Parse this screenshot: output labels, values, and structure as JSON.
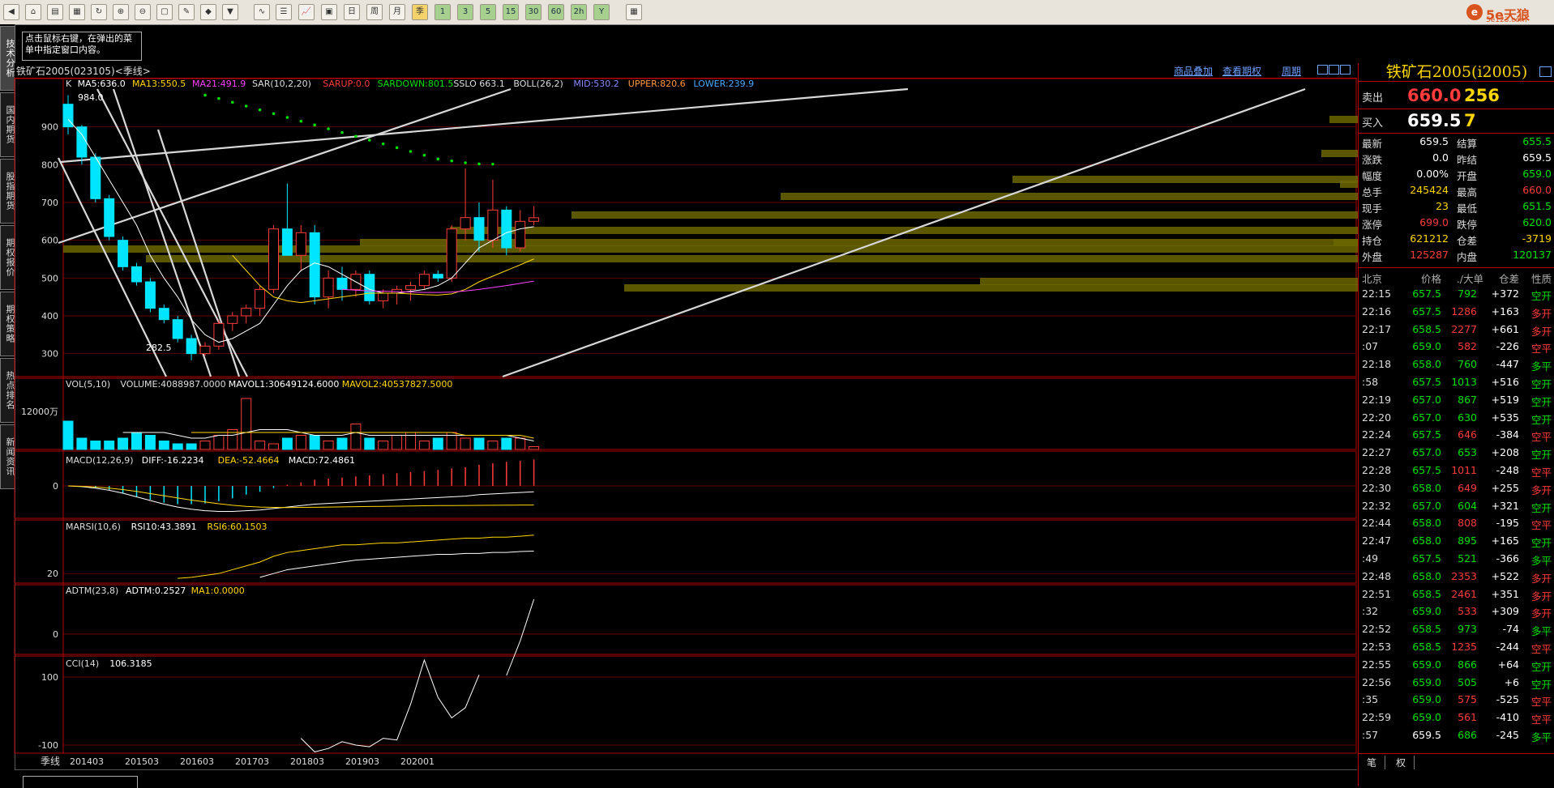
{
  "colors": {
    "up": "#ff3b3b",
    "down": "#00e5ff",
    "grid": "#8b0000",
    "text": "#dddddd",
    "bar": "#6b6600",
    "accent": "#ffd700"
  },
  "toolbar": {
    "icons": [
      "back-icon",
      "home-icon",
      "folder-icon",
      "quote-icon",
      "refresh-icon",
      "zoom-in-icon",
      "zoom-out-icon",
      "window-icon",
      "draw-icon",
      "paint-icon",
      "filter-icon",
      "indicator-icon",
      "list-icon",
      "chart-icon",
      "news-icon",
      "daily-icon",
      "weekly-icon",
      "monthly-icon",
      "quarterly-icon",
      "min1-icon",
      "min3-icon",
      "min5-icon",
      "min15-icon",
      "min30-icon",
      "min60-icon",
      "multi-icon",
      "year-icon",
      "calc-icon"
    ],
    "period_labels": [
      "1",
      "3",
      "5",
      "15",
      "30",
      "60",
      "2h",
      "Y"
    ],
    "brand": "5e天狼",
    "brand_url": "5e123.com"
  },
  "left_tabs": [
    "技术分析",
    "国内期货",
    "股指期货",
    "期权报价",
    "期权策略",
    "热点排名",
    "新闻资讯"
  ],
  "hint": "点击鼠标右键，在弹出的菜单中指定窗口内容。",
  "chart": {
    "title": "铁矿石2005(023105)<季线>",
    "links": [
      "商品叠加",
      "查看期权",
      "周期"
    ],
    "main_legend": [
      {
        "text": "K",
        "color": "#dddddd"
      },
      {
        "text": "MA5:636.0",
        "color": "#ffffff"
      },
      {
        "text": "MA13:550.5",
        "color": "#ffd700"
      },
      {
        "text": "MA21:491.9",
        "color": "#ff40ff"
      },
      {
        "text": "SAR(10,2,20)",
        "color": "#dddddd"
      },
      {
        "text": "SARUP:0.0",
        "color": "#ff3b3b"
      },
      {
        "text": "SARDOWN:801.5",
        "color": "#00e000"
      },
      {
        "text": "SSLO 663.1",
        "color": "#dddddd"
      },
      {
        "text": "BOLL(26,2)",
        "color": "#dddddd"
      },
      {
        "text": "MID:530.2",
        "color": "#8a8aff"
      },
      {
        "text": "UPPER:820.6",
        "color": "#ff9a40"
      },
      {
        "text": "LOWER:239.9",
        "color": "#4aa8ff"
      }
    ],
    "main_axis": [
      "900",
      "800",
      "700",
      "600",
      "500",
      "400",
      "300"
    ],
    "high_label": "984.0",
    "low_label": "282.5",
    "vol_legend": [
      {
        "text": "VOL(5,10)",
        "color": "#dddddd"
      },
      {
        "text": "VOLUME:4088987.0000",
        "color": "#dddddd"
      },
      {
        "text": "MAVOL1:30649124.6000",
        "color": "#ffffff"
      },
      {
        "text": "MAVOL2:40537827.5000",
        "color": "#ffd700"
      }
    ],
    "vol_axis": "12000万",
    "macd_legend": [
      {
        "text": "MACD(12,26,9)",
        "color": "#dddddd"
      },
      {
        "text": "DIFF:-16.2234",
        "color": "#ffffff"
      },
      {
        "text": "DEA:-52.4664",
        "color": "#ffd700"
      },
      {
        "text": "MACD:72.4861",
        "color": "#ffffff"
      }
    ],
    "macd_axis": "0",
    "marsi_legend": [
      {
        "text": "MARSI(10,6)",
        "color": "#dddddd"
      },
      {
        "text": "RSI10:43.3891",
        "color": "#ffffff"
      },
      {
        "text": "RSI6:60.1503",
        "color": "#ffd700"
      }
    ],
    "marsi_axis": "20",
    "adtm_legend": [
      {
        "text": "ADTM(23,8)",
        "color": "#dddddd"
      },
      {
        "text": "ADTM:0.2527",
        "color": "#ffffff"
      },
      {
        "text": "MA1:0.0000",
        "color": "#ffd700"
      }
    ],
    "adtm_axis": "0",
    "cci_legend": [
      {
        "text": "CCI(14)",
        "color": "#dddddd"
      },
      {
        "text": "106.3185",
        "color": "#ffffff"
      }
    ],
    "cci_axis": [
      "100",
      "-100"
    ],
    "period_label": "季线",
    "x_labels": [
      "201403",
      "201503",
      "201603",
      "201703",
      "201803",
      "201903",
      "202001"
    ]
  },
  "quote": {
    "title": "铁矿石2005(i2005)",
    "sell": {
      "label": "卖出",
      "price": "660.0",
      "vol": "256"
    },
    "buy": {
      "label": "买入",
      "price": "659.5",
      "vol": "7"
    },
    "stats": [
      {
        "l1": "最新",
        "v1": "659.5",
        "c1": "#ffffff",
        "l2": "结算",
        "v2": "655.5",
        "c2": "#00e000"
      },
      {
        "l1": "涨跌",
        "v1": "0.0",
        "c1": "#ffffff",
        "l2": "昨结",
        "v2": "659.5",
        "c2": "#ffffff"
      },
      {
        "l1": "幅度",
        "v1": "0.00%",
        "c1": "#ffffff",
        "l2": "开盘",
        "v2": "659.0",
        "c2": "#00e000"
      },
      {
        "l1": "总手",
        "v1": "245424",
        "c1": "#ffd700",
        "l2": "最高",
        "v2": "660.0",
        "c2": "#ff3b3b"
      },
      {
        "l1": "现手",
        "v1": "23",
        "c1": "#ffd700",
        "l2": "最低",
        "v2": "651.5",
        "c2": "#00e000"
      },
      {
        "l1": "涨停",
        "v1": "699.0",
        "c1": "#ff3b3b",
        "l2": "跌停",
        "v2": "620.0",
        "c2": "#00e000"
      },
      {
        "l1": "持仓",
        "v1": "621212",
        "c1": "#ffd700",
        "l2": "仓差",
        "v2": "-3719",
        "c2": "#ffd700"
      },
      {
        "l1": "外盘",
        "v1": "125287",
        "c1": "#ff3b3b",
        "l2": "内盘",
        "v2": "120137",
        "c2": "#00e000"
      }
    ],
    "tick_header": {
      "time": "北京",
      "price": "价格",
      "vol": "./大单",
      "chg": "仓差",
      "nature": "性质"
    },
    "ticks": [
      {
        "time": "22:15",
        "price": "657.5",
        "vol": "792",
        "chg": "+372",
        "nature": "空开",
        "pc": "#00e000",
        "vc": "#00e000",
        "nc": "#00e000"
      },
      {
        "time": "22:16",
        "price": "657.5",
        "vol": "1286",
        "chg": "+163",
        "nature": "多开",
        "pc": "#00e000",
        "vc": "#ff3b3b",
        "nc": "#ff3b3b"
      },
      {
        "time": "22:17",
        "price": "658.5",
        "vol": "2277",
        "chg": "+661",
        "nature": "多开",
        "pc": "#00e000",
        "vc": "#ff3b3b",
        "nc": "#ff3b3b"
      },
      {
        "time": ":07",
        "price": "659.0",
        "vol": "582",
        "chg": "-226",
        "nature": "空平",
        "pc": "#00e000",
        "vc": "#ff3b3b",
        "nc": "#ff3b3b"
      },
      {
        "time": "22:18",
        "price": "658.0",
        "vol": "760",
        "chg": "-447",
        "nature": "多平",
        "pc": "#00e000",
        "vc": "#00e000",
        "nc": "#00e000"
      },
      {
        "time": ":58",
        "price": "657.5",
        "vol": "1013",
        "chg": "+516",
        "nature": "空开",
        "pc": "#00e000",
        "vc": "#00e000",
        "nc": "#00e000"
      },
      {
        "time": "22:19",
        "price": "657.0",
        "vol": "867",
        "chg": "+519",
        "nature": "空开",
        "pc": "#00e000",
        "vc": "#00e000",
        "nc": "#00e000"
      },
      {
        "time": "22:20",
        "price": "657.0",
        "vol": "630",
        "chg": "+535",
        "nature": "空开",
        "pc": "#00e000",
        "vc": "#00e000",
        "nc": "#00e000"
      },
      {
        "time": "22:24",
        "price": "657.5",
        "vol": "646",
        "chg": "-384",
        "nature": "空平",
        "pc": "#00e000",
        "vc": "#ff3b3b",
        "nc": "#ff3b3b"
      },
      {
        "time": "22:27",
        "price": "657.0",
        "vol": "653",
        "chg": "+208",
        "nature": "空开",
        "pc": "#00e000",
        "vc": "#00e000",
        "nc": "#00e000"
      },
      {
        "time": "22:28",
        "price": "657.5",
        "vol": "1011",
        "chg": "-248",
        "nature": "空平",
        "pc": "#00e000",
        "vc": "#ff3b3b",
        "nc": "#ff3b3b"
      },
      {
        "time": "22:30",
        "price": "658.0",
        "vol": "649",
        "chg": "+255",
        "nature": "多开",
        "pc": "#00e000",
        "vc": "#ff3b3b",
        "nc": "#ff3b3b"
      },
      {
        "time": "22:32",
        "price": "657.0",
        "vol": "604",
        "chg": "+321",
        "nature": "空开",
        "pc": "#00e000",
        "vc": "#00e000",
        "nc": "#00e000"
      },
      {
        "time": "22:44",
        "price": "658.0",
        "vol": "808",
        "chg": "-195",
        "nature": "空平",
        "pc": "#00e000",
        "vc": "#ff3b3b",
        "nc": "#ff3b3b"
      },
      {
        "time": "22:47",
        "price": "658.0",
        "vol": "895",
        "chg": "+165",
        "nature": "空开",
        "pc": "#00e000",
        "vc": "#00e000",
        "nc": "#00e000"
      },
      {
        "time": ":49",
        "price": "657.5",
        "vol": "521",
        "chg": "-366",
        "nature": "多平",
        "pc": "#00e000",
        "vc": "#00e000",
        "nc": "#00e000"
      },
      {
        "time": "22:48",
        "price": "658.0",
        "vol": "2353",
        "chg": "+522",
        "nature": "多开",
        "pc": "#00e000",
        "vc": "#ff3b3b",
        "nc": "#ff3b3b"
      },
      {
        "time": "22:51",
        "price": "658.5",
        "vol": "2461",
        "chg": "+351",
        "nature": "多开",
        "pc": "#00e000",
        "vc": "#ff3b3b",
        "nc": "#ff3b3b"
      },
      {
        "time": ":32",
        "price": "659.0",
        "vol": "533",
        "chg": "+309",
        "nature": "多开",
        "pc": "#00e000",
        "vc": "#ff3b3b",
        "nc": "#ff3b3b"
      },
      {
        "time": "22:52",
        "price": "658.5",
        "vol": "973",
        "chg": "-74",
        "nature": "多平",
        "pc": "#00e000",
        "vc": "#00e000",
        "nc": "#00e000"
      },
      {
        "time": "22:53",
        "price": "658.5",
        "vol": "1235",
        "chg": "-244",
        "nature": "空平",
        "pc": "#00e000",
        "vc": "#ff3b3b",
        "nc": "#ff3b3b"
      },
      {
        "time": "22:55",
        "price": "659.0",
        "vol": "866",
        "chg": "+64",
        "nature": "空开",
        "pc": "#00e000",
        "vc": "#00e000",
        "nc": "#00e000"
      },
      {
        "time": "22:56",
        "price": "659.0",
        "vol": "505",
        "chg": "+6",
        "nature": "空开",
        "pc": "#00e000",
        "vc": "#00e000",
        "nc": "#00e000"
      },
      {
        "time": ":35",
        "price": "659.0",
        "vol": "575",
        "chg": "-525",
        "nature": "空平",
        "pc": "#00e000",
        "vc": "#ff3b3b",
        "nc": "#ff3b3b"
      },
      {
        "time": "22:59",
        "price": "659.0",
        "vol": "561",
        "chg": "-410",
        "nature": "空平",
        "pc": "#00e000",
        "vc": "#ff3b3b",
        "nc": "#ff3b3b"
      },
      {
        "time": ":57",
        "price": "659.5",
        "vol": "686",
        "chg": "-245",
        "nature": "多平",
        "pc": "#ffffff",
        "vc": "#00e000",
        "nc": "#00e000"
      }
    ],
    "tabs": [
      "笔",
      "权"
    ]
  },
  "chart_data": {
    "type": "candlestick",
    "symbol": "铁矿石2005",
    "period": "季线",
    "ylim": [
      250,
      1000
    ],
    "candles": [
      [
        960,
        984,
        880,
        900
      ],
      [
        900,
        905,
        800,
        820
      ],
      [
        820,
        830,
        700,
        710
      ],
      [
        710,
        720,
        600,
        610
      ],
      [
        600,
        610,
        520,
        530
      ],
      [
        530,
        540,
        480,
        490
      ],
      [
        490,
        500,
        410,
        420
      ],
      [
        420,
        430,
        380,
        390
      ],
      [
        390,
        400,
        330,
        340
      ],
      [
        340,
        350,
        282.5,
        300
      ],
      [
        300,
        330,
        295,
        320
      ],
      [
        320,
        390,
        310,
        380
      ],
      [
        380,
        410,
        360,
        400
      ],
      [
        400,
        430,
        380,
        420
      ],
      [
        420,
        480,
        400,
        470
      ],
      [
        470,
        640,
        460,
        630
      ],
      [
        630,
        750,
        600,
        560
      ],
      [
        560,
        640,
        520,
        620
      ],
      [
        620,
        640,
        430,
        450
      ],
      [
        450,
        520,
        420,
        500
      ],
      [
        500,
        530,
        440,
        470
      ],
      [
        470,
        520,
        450,
        510
      ],
      [
        510,
        520,
        430,
        440
      ],
      [
        440,
        470,
        420,
        460
      ],
      [
        460,
        480,
        430,
        470
      ],
      [
        470,
        490,
        440,
        480
      ],
      [
        480,
        520,
        470,
        510
      ],
      [
        510,
        520,
        490,
        500
      ],
      [
        500,
        640,
        490,
        630
      ],
      [
        630,
        790,
        600,
        660
      ],
      [
        660,
        700,
        570,
        600
      ],
      [
        600,
        760,
        580,
        680
      ],
      [
        680,
        690,
        560,
        580
      ],
      [
        580,
        680,
        570,
        650
      ],
      [
        650,
        690,
        640,
        659.5
      ]
    ],
    "ma5": [
      920,
      880,
      820,
      760,
      700,
      640,
      560,
      500,
      450,
      390,
      350,
      330,
      340,
      360,
      380,
      430,
      480,
      520,
      540,
      530,
      510,
      490,
      470,
      460,
      460,
      465,
      470,
      480,
      500,
      540,
      580,
      600,
      620,
      630,
      636
    ],
    "ma13": [
      null,
      null,
      null,
      null,
      null,
      null,
      null,
      null,
      null,
      null,
      null,
      null,
      560,
      520,
      480,
      450,
      440,
      435,
      440,
      445,
      450,
      455,
      460,
      460,
      460,
      458,
      456,
      455,
      458,
      470,
      490,
      505,
      520,
      535,
      550.5
    ],
    "ma21": [
      null,
      null,
      null,
      null,
      null,
      null,
      null,
      null,
      null,
      null,
      null,
      null,
      null,
      null,
      null,
      null,
      null,
      null,
      null,
      null,
      470,
      468,
      466,
      465,
      464,
      463,
      462,
      462,
      463,
      466,
      470,
      475,
      480,
      486,
      491.9
    ],
    "sar": [
      null,
      null,
      null,
      null,
      null,
      null,
      null,
      null,
      null,
      null,
      984,
      975,
      965,
      955,
      945,
      935,
      925,
      915,
      905,
      895,
      885,
      875,
      865,
      855,
      845,
      835,
      825,
      815,
      810,
      805,
      802,
      801.5,
      null,
      null,
      null
    ],
    "volume": [
      10,
      4,
      3,
      3,
      4,
      6,
      5,
      3,
      2,
      2,
      3,
      5,
      7,
      18,
      3,
      2,
      4,
      5,
      5,
      3,
      4,
      9,
      4,
      3,
      5,
      6,
      3,
      4,
      6,
      4,
      4,
      3,
      4,
      4,
      1
    ],
    "mavol1": [
      null,
      null,
      null,
      null,
      6,
      6,
      6,
      6,
      5,
      4,
      4,
      5,
      5,
      6,
      7,
      7,
      7,
      6,
      5,
      5,
      5,
      6,
      5,
      5,
      5,
      5,
      5,
      5,
      5,
      5,
      5,
      5,
      5,
      4,
      3
    ],
    "mavol2": [
      null,
      null,
      null,
      null,
      null,
      null,
      null,
      null,
      null,
      6,
      6,
      6,
      6,
      6,
      6,
      6,
      6,
      6,
      6,
      6,
      6,
      6,
      6,
      6,
      6,
      6,
      6,
      6,
      6,
      5,
      5,
      5,
      5,
      5,
      4
    ],
    "macd_diff": [
      0,
      -2,
      -6,
      -12,
      -20,
      -30,
      -40,
      -50,
      -58,
      -64,
      -68,
      -70,
      -70,
      -68,
      -66,
      -62,
      -58,
      -54,
      -50,
      -48,
      -46,
      -44,
      -42,
      -40,
      -38,
      -36,
      -34,
      -32,
      -30,
      -28,
      -24,
      -22,
      -20,
      -18,
      -16.2
    ],
    "macd_dea": [
      0,
      -1,
      -3,
      -6,
      -10,
      -15,
      -21,
      -27,
      -33,
      -39,
      -44,
      -49,
      -53,
      -56,
      -58,
      -59,
      -59.5,
      -59,
      -58.5,
      -58,
      -57.5,
      -57,
      -56.5,
      -56,
      -55.5,
      -55,
      -54.5,
      -54,
      -53.8,
      -53.5,
      -53.2,
      -53,
      -52.8,
      -52.6,
      -52.47
    ],
    "macd_hist": [
      0,
      -2,
      -6,
      -12,
      -20,
      -30,
      -38,
      -46,
      -50,
      -50,
      -48,
      -42,
      -34,
      -24,
      -16,
      -6,
      3,
      10,
      17,
      20,
      23,
      26,
      29,
      32,
      35,
      38,
      41,
      44,
      48,
      51,
      58,
      62,
      66,
      69,
      72.5
    ],
    "rsi6": [
      null,
      null,
      null,
      null,
      null,
      null,
      null,
      null,
      15,
      16,
      18,
      20,
      24,
      28,
      32,
      38,
      42,
      44,
      46,
      48,
      50,
      50,
      51,
      52,
      52,
      53,
      54,
      55,
      56,
      57,
      57,
      58,
      58,
      59,
      60.15
    ],
    "rsi10": [
      null,
      null,
      null,
      null,
      null,
      null,
      null,
      null,
      null,
      null,
      null,
      null,
      null,
      null,
      16,
      20,
      24,
      26,
      28,
      30,
      32,
      34,
      35,
      36,
      37,
      38,
      39,
      40,
      40,
      41,
      41,
      42,
      42,
      43,
      43.39
    ],
    "adtm": [
      null,
      null,
      null,
      null,
      null,
      null,
      null,
      null,
      null,
      null,
      null,
      null,
      null,
      null,
      null,
      null,
      null,
      null,
      null,
      null,
      null,
      null,
      null,
      null,
      null,
      null,
      null,
      null,
      null,
      null,
      null,
      null,
      -0.3,
      -0.05,
      0.2527
    ],
    "cci": [
      null,
      null,
      null,
      null,
      null,
      null,
      null,
      null,
      null,
      null,
      null,
      null,
      null,
      null,
      null,
      null,
      null,
      -80,
      -120,
      -110,
      -90,
      -100,
      -105,
      -80,
      -85,
      20,
      150,
      40,
      -20,
      10,
      106.3
    ],
    "x_labels": [
      "201403",
      "201503",
      "201603",
      "201703",
      "201803",
      "201903",
      "202001"
    ]
  }
}
